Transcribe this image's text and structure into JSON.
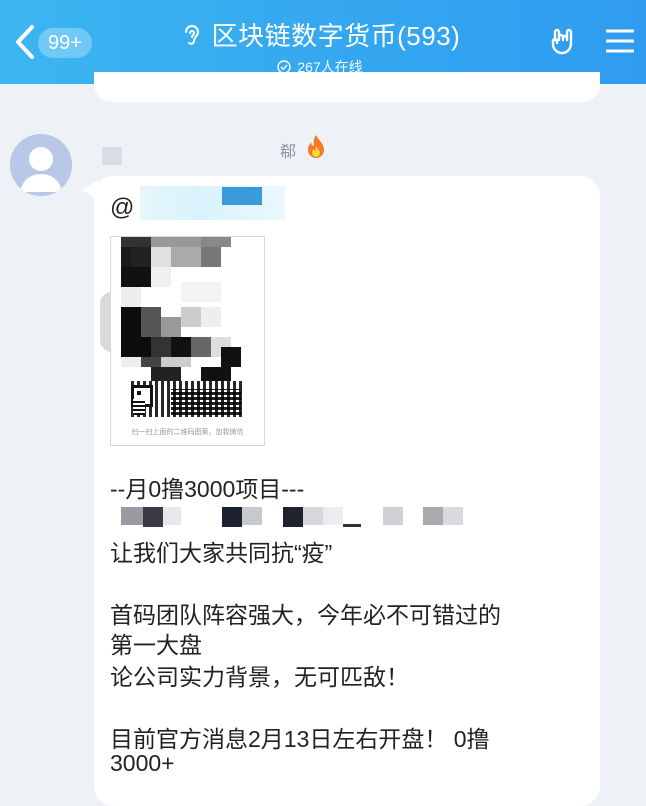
{
  "header": {
    "back_label": "back",
    "unread_badge": "99+",
    "title": "区块链数字货币(593)",
    "online": "267人在线",
    "icons": {
      "back": "chevron-left-icon",
      "ear": "ear-icon",
      "online": "online-check-icon",
      "hand": "rock-hand-icon",
      "menu": "hamburger-menu-icon"
    },
    "color": "#35a8f0"
  },
  "message": {
    "level": "郗",
    "mention_prefix": "@",
    "qr_caption": "扫一扫上面的二维码图案，加我微信",
    "lines": [
      "--月0撸3000项目---",
      "让我们大家共同抗“疫”",
      "首码团队阵容强大，今年必不可错过的",
      "第一大盘",
      "论公司实力背景，无可匹敌！",
      "目前官方消息2月13日左右开盘！ 0撸",
      "3000+"
    ]
  }
}
